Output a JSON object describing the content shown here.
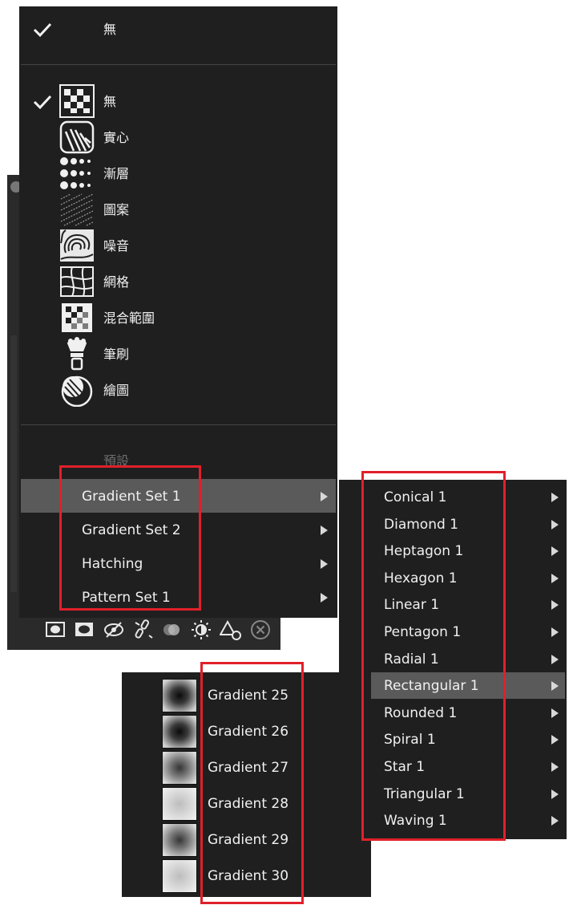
{
  "top_item": {
    "label": "無"
  },
  "type_items": [
    {
      "label": "無",
      "icon": "checker-none-icon",
      "checked": true
    },
    {
      "label": "實心",
      "icon": "solid-fill-icon"
    },
    {
      "label": "漸層",
      "icon": "gradient-dots-icon"
    },
    {
      "label": "圖案",
      "icon": "pattern-hatch-icon"
    },
    {
      "label": "噪音",
      "icon": "noise-icon"
    },
    {
      "label": "網格",
      "icon": "mesh-grid-icon"
    },
    {
      "label": "混合範圍",
      "icon": "blend-range-icon"
    },
    {
      "label": "筆刷",
      "icon": "brush-icon"
    },
    {
      "label": "繪圖",
      "icon": "paint-icon"
    }
  ],
  "preset_header": "預設",
  "sets": [
    "Gradient Set 1",
    "Gradient Set 2",
    "Hatching",
    "Pattern Set 1"
  ],
  "shapes": [
    "Conical 1",
    "Diamond 1",
    "Heptagon 1",
    "Hexagon 1",
    "Linear 1",
    "Pentagon 1",
    "Radial 1",
    "Rectangular 1",
    "Rounded 1",
    "Spiral 1",
    "Star 1",
    "Triangular 1",
    "Waving 1"
  ],
  "gradients": [
    "Gradient 25",
    "Gradient 26",
    "Gradient 27",
    "Gradient 28",
    "Gradient 29",
    "Gradient 30"
  ],
  "toolbar_icons": [
    "mask-rect-icon",
    "mask-ellipse-icon",
    "hide-eye-icon",
    "unlink-icon",
    "blend-circles-icon",
    "brightness-icon",
    "shapes-icon",
    "close-circle-icon"
  ],
  "colors": {
    "menu_bg": "#1f1f1f",
    "highlight": "#5a5a5a",
    "annotation_red": "#e0202a"
  }
}
